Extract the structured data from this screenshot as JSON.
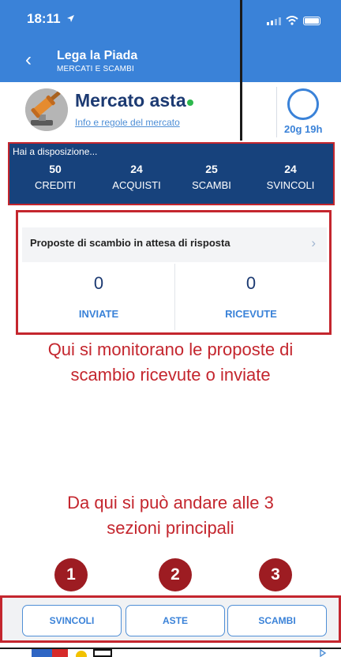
{
  "status_bar": {
    "time": "18:11"
  },
  "nav": {
    "title": "Lega la Piada",
    "subtitle": "MERCATI E SCAMBI"
  },
  "market": {
    "title": "Mercato asta",
    "rules_link": "Info e regole del mercato",
    "countdown": "20g 19h"
  },
  "availability": {
    "label": "Hai a disposizione...",
    "items": [
      {
        "value": "50",
        "label": "CREDITI"
      },
      {
        "value": "24",
        "label": "ACQUISTI"
      },
      {
        "value": "25",
        "label": "SCAMBI"
      },
      {
        "value": "24",
        "label": "SVINCOLI"
      }
    ]
  },
  "proposals": {
    "header": "Proposte di scambio in attesa di risposta",
    "sent": {
      "value": "0",
      "label": "INVIATE"
    },
    "received": {
      "value": "0",
      "label": "RICEVUTE"
    }
  },
  "annotations": {
    "proposals_note_line1": "Qui si monitorano le proposte di",
    "proposals_note_line2": "scambio ricevute o inviate",
    "sections_note_line1": "Da qui si può andare alle 3",
    "sections_note_line2": "sezioni principali",
    "badges": [
      "1",
      "2",
      "3"
    ]
  },
  "tabs": [
    "SVINCOLI",
    "ASTE",
    "SCAMBI"
  ],
  "colors": {
    "brand_blue": "#3a82d8",
    "navy": "#17427c",
    "annotation_red": "#c4262e",
    "badge_red": "#9d1c22",
    "status_green": "#2db84d"
  }
}
